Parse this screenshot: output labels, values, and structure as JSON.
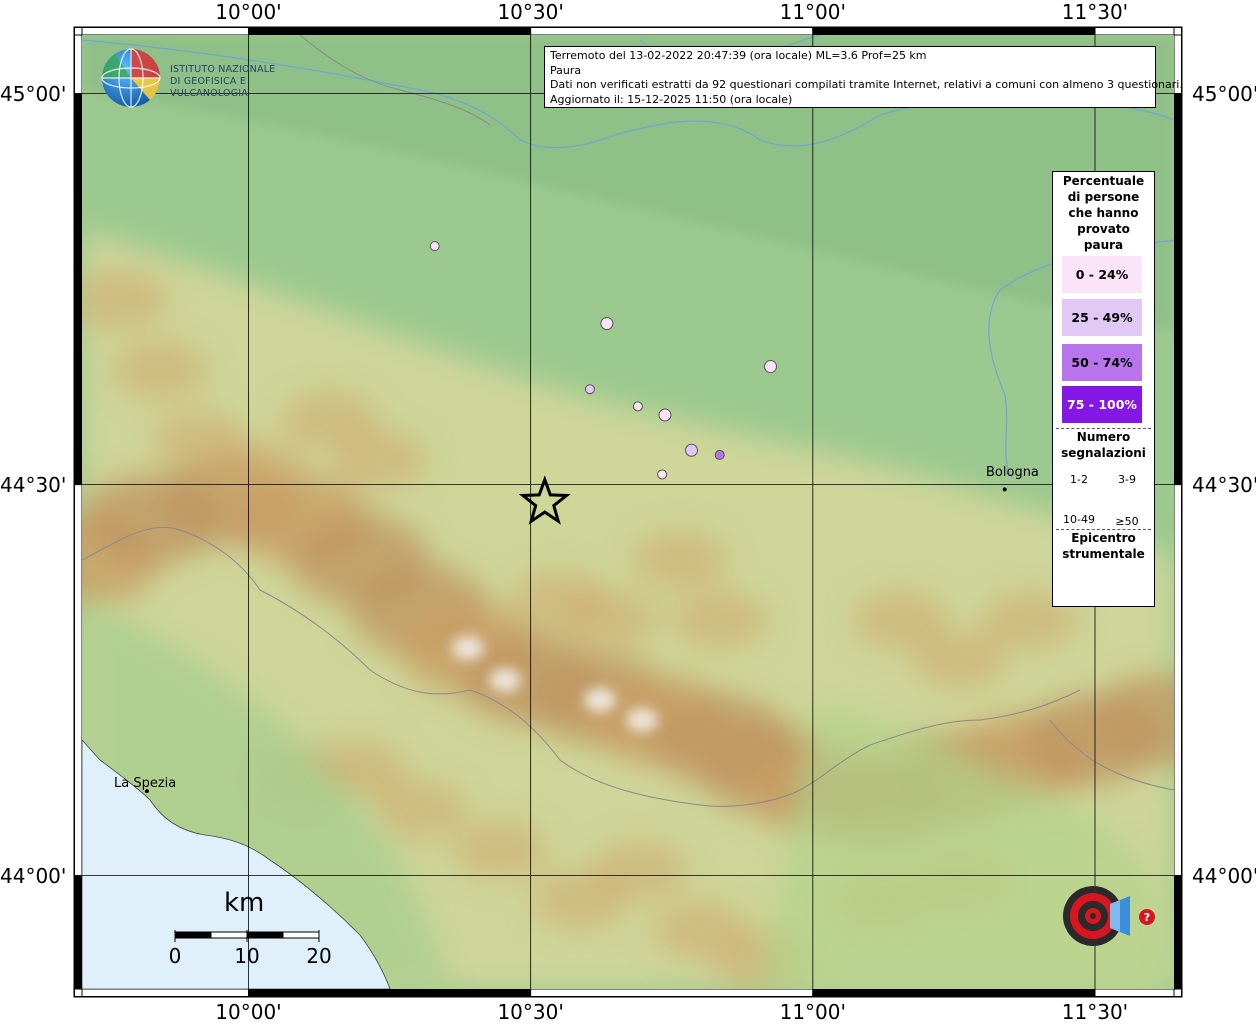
{
  "map": {
    "extent": {
      "lon_min": 9.705,
      "lon_max": 11.64,
      "lat_min": 43.855,
      "lat_max": 45.075
    },
    "grid": {
      "lons": [
        10.0,
        10.5,
        11.0,
        11.5
      ],
      "lats": [
        44.0,
        44.5,
        45.0
      ]
    },
    "tick_labels": {
      "lon": [
        "10°00'",
        "10°30'",
        "11°00'",
        "11°30'"
      ],
      "lat": [
        "45°00'",
        "44°30'",
        "44°00'"
      ]
    },
    "colors": {
      "sea": "#dff0fb",
      "plain": "#9cc98f",
      "hill": "#dcd8a0",
      "mountain": "#b88c5a",
      "peak": "#f4f0ea",
      "river": "#6ea8d4",
      "border": "#888888"
    }
  },
  "logo": {
    "line1": "ISTITUTO NAZIONALE",
    "line2": "DI GEOFISICA E VULCANOLOGIA"
  },
  "info": {
    "line1": "Terremoto del 13-02-2022 20:47:39 (ora locale) ML=3.6 Prof=25 km",
    "line2": "Paura",
    "line3": "Dati non verificati estratti da 92 questionari compilati tramite Internet, relativi a comuni con almeno 3 questionari.",
    "line4": "Aggiornato il: 15-12-2025 11:50 (ora locale)"
  },
  "legend": {
    "title_lines": [
      "Percentuale",
      "di persone",
      "che hanno",
      "provato",
      "paura"
    ],
    "classes": [
      {
        "label": "0 - 24%",
        "color": "#fbe3f8",
        "text_color": "#000000"
      },
      {
        "label": "25 - 49%",
        "color": "#e2c8f4",
        "text_color": "#000000"
      },
      {
        "label": "50 - 74%",
        "color": "#b774ec",
        "text_color": "#000000"
      },
      {
        "label": "75 - 100%",
        "color": "#8417e6",
        "text_color": "#ffffff"
      }
    ],
    "count_title_lines": [
      "Numero",
      "segnalazioni"
    ],
    "sizes": [
      "1-2",
      "3-9",
      "10-49",
      "≥50"
    ],
    "epicenter_title_lines": [
      "Epicentro",
      "strumentale"
    ]
  },
  "epicenter": {
    "lon": 10.525,
    "lat": 44.477
  },
  "observations": [
    {
      "lon": 10.33,
      "lat": 44.805,
      "class": 0,
      "size": 0
    },
    {
      "lon": 10.635,
      "lat": 44.706,
      "class": 0,
      "size": 1
    },
    {
      "lon": 10.605,
      "lat": 44.622,
      "class": 1,
      "size": 0
    },
    {
      "lon": 10.925,
      "lat": 44.651,
      "class": 0,
      "size": 1
    },
    {
      "lon": 10.69,
      "lat": 44.6,
      "class": 0,
      "size": 0
    },
    {
      "lon": 10.738,
      "lat": 44.589,
      "class": 0,
      "size": 1
    },
    {
      "lon": 10.785,
      "lat": 44.544,
      "class": 1,
      "size": 1
    },
    {
      "lon": 10.835,
      "lat": 44.538,
      "class": 2,
      "size": 0
    },
    {
      "lon": 10.733,
      "lat": 44.513,
      "class": 0,
      "size": 0
    }
  ],
  "cities": [
    {
      "name": "Bologna",
      "lon": 11.34,
      "lat": 44.494
    },
    {
      "name": "La Spezia",
      "lon": 9.82,
      "lat": 44.108
    }
  ],
  "scale_bar": {
    "unit": "km",
    "labels": [
      "0",
      "10",
      "20"
    ],
    "values_km": [
      0,
      10,
      20
    ]
  }
}
